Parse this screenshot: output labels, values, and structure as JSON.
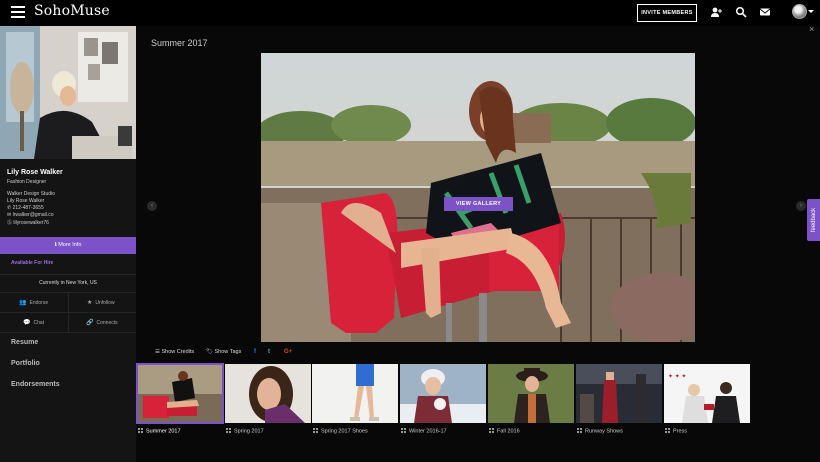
{
  "app": {
    "logo": "SohoMuse"
  },
  "topbar": {
    "invite_label": "INVITE MEMBERS"
  },
  "profile": {
    "name": "Lily Rose Walker",
    "title": "Fashion Designer",
    "company": "Walker Design Studio",
    "contact_name": "Lily Rose Walker",
    "phone": "212-487-3655",
    "email": "lrwalker@gmail.co",
    "skype": "lilyrosewalker76",
    "more_info_label": "More Info",
    "availability": "Available For Hire",
    "location": "Currently in New York, US",
    "actions": {
      "endorse": "Endorse",
      "unfollow": "Unfollow",
      "chat": "Chat",
      "connects": "Connects"
    },
    "sections": [
      "Resume",
      "Portfolio",
      "Endorsements"
    ]
  },
  "viewer": {
    "album_title": "Summer 2017",
    "view_gallery_label": "VIEW GALLERY",
    "show_credits": "Show Credits",
    "show_tags": "Show Tags",
    "social": {
      "facebook": "f",
      "twitter": "t",
      "googleplus": "G+"
    },
    "feedback_label": "feedback",
    "close": "×"
  },
  "albums": [
    {
      "label": "Summer 2017",
      "active": true
    },
    {
      "label": "Spring 2017",
      "active": false
    },
    {
      "label": "Spring 2017 Shoes",
      "active": false
    },
    {
      "label": "Winter 2016-17",
      "active": false
    },
    {
      "label": "Fall 2016",
      "active": false
    },
    {
      "label": "Runway Shows",
      "active": false
    },
    {
      "label": "Press",
      "active": false
    }
  ],
  "colors": {
    "accent": "#7b52c7",
    "background": "#0c0c0c",
    "sidebar": "#141414",
    "red_chair": "#d8223a"
  }
}
